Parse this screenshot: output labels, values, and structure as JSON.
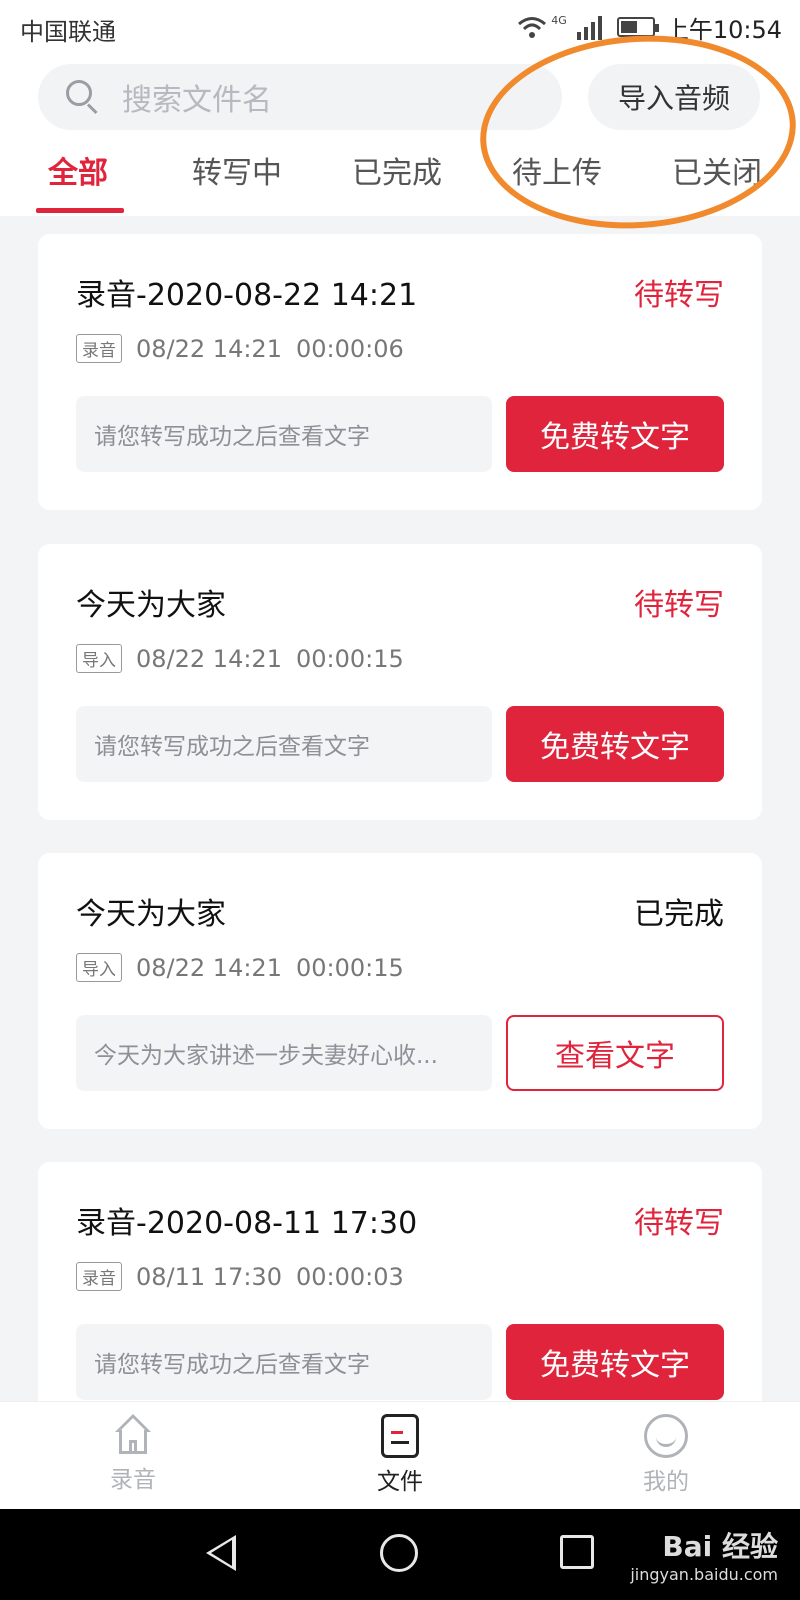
{
  "status_bar": {
    "carrier": "中国联通",
    "network": "4G",
    "time": "上午10:54"
  },
  "search": {
    "placeholder": "搜索文件名"
  },
  "import_button": "导入音频",
  "tabs": [
    {
      "label": "全部",
      "active": true
    },
    {
      "label": "转写中",
      "active": false
    },
    {
      "label": "已完成",
      "active": false
    },
    {
      "label": "待上传",
      "active": false
    },
    {
      "label": "已关闭",
      "active": false
    }
  ],
  "cards": [
    {
      "title": "录音-2020-08-22 14:21",
      "status": "待转写",
      "status_type": "pending",
      "tag": "录音",
      "date": "08/22 14:21",
      "duration": "00:00:06",
      "preview": "请您转写成功之后查看文字",
      "action": "免费转文字",
      "action_style": "primary"
    },
    {
      "title": "今天为大家",
      "status": "待转写",
      "status_type": "pending",
      "tag": "导入",
      "date": "08/22 14:21",
      "duration": "00:00:15",
      "preview": "请您转写成功之后查看文字",
      "action": "免费转文字",
      "action_style": "primary"
    },
    {
      "title": "今天为大家",
      "status": "已完成",
      "status_type": "done",
      "tag": "导入",
      "date": "08/22 14:21",
      "duration": "00:00:15",
      "preview": "今天为大家讲述一步夫妻好心收...",
      "action": "查看文字",
      "action_style": "outline"
    },
    {
      "title": "录音-2020-08-11 17:30",
      "status": "待转写",
      "status_type": "pending",
      "tag": "录音",
      "date": "08/11 17:30",
      "duration": "00:00:03",
      "preview": "请您转写成功之后查看文字",
      "action": "免费转文字",
      "action_style": "primary"
    }
  ],
  "bottom_nav": [
    {
      "label": "录音",
      "icon": "home-icon",
      "active": false
    },
    {
      "label": "文件",
      "icon": "file-icon",
      "active": true
    },
    {
      "label": "我的",
      "icon": "smile-icon",
      "active": false
    }
  ],
  "watermark": {
    "main": "Bai 经验",
    "sub": "jingyan.baidu.com"
  },
  "colors": {
    "accent": "#e0243c",
    "annotation": "#f08a2d",
    "background": "#f3f4f6"
  }
}
